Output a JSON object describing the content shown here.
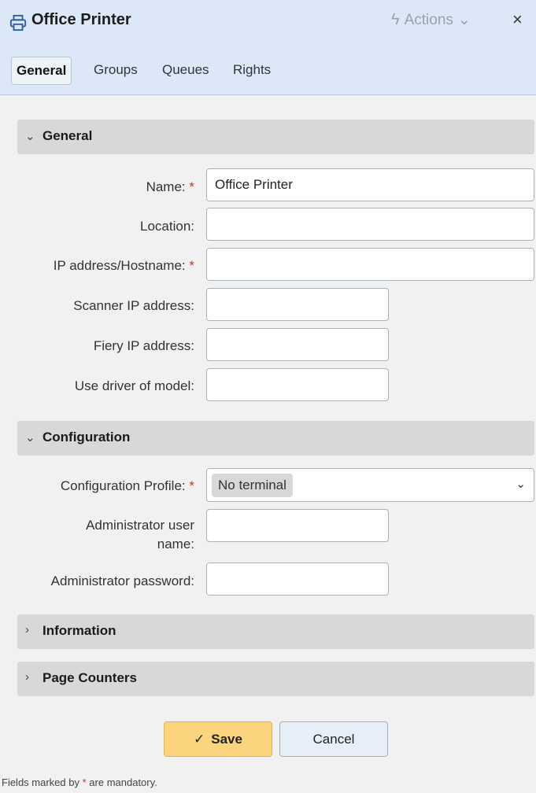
{
  "header": {
    "title": "Office Printer",
    "title_icon": "printer-icon",
    "actions_label": "Actions",
    "actions_icon": "bolt-icon",
    "close_glyph": "×"
  },
  "tabs": [
    {
      "label": "General",
      "active": true
    },
    {
      "label": "Groups",
      "active": false
    },
    {
      "label": "Queues",
      "active": false
    },
    {
      "label": "Rights",
      "active": false
    }
  ],
  "sections": {
    "general": {
      "title": "General",
      "expanded": true,
      "fields": {
        "name": {
          "label": "Name:",
          "value": "Office Printer",
          "required": true
        },
        "location": {
          "label": "Location:",
          "value": ""
        },
        "ip": {
          "label": "IP address/Hostname:",
          "value": "",
          "required": true
        },
        "scanner_ip": {
          "label": "Scanner IP address:",
          "value": ""
        },
        "fiery_ip": {
          "label": "Fiery IP address:",
          "value": ""
        },
        "driver_model": {
          "label": "Use driver of model:",
          "value": ""
        }
      }
    },
    "configuration": {
      "title": "Configuration",
      "expanded": true,
      "fields": {
        "profile": {
          "label": "Configuration Profile:",
          "value": "No terminal",
          "required": true
        },
        "admin_user_line1": "Administrator user",
        "admin_user_line2": "name:",
        "admin_password": {
          "label": "Administrator password:",
          "value": ""
        }
      }
    },
    "information": {
      "title": "Information",
      "expanded": false
    },
    "page_counters": {
      "title": "Page Counters",
      "expanded": false
    }
  },
  "footer": {
    "save_label": "Save",
    "cancel_label": "Cancel",
    "note_prefix": "Fields marked by",
    "note_star": "*",
    "note_suffix": "are mandatory."
  },
  "colors": {
    "header_bg": "#dce8f7",
    "save_bg": "#fbd57e",
    "cancel_bg": "#e6eef8",
    "required": "#c0392b"
  }
}
